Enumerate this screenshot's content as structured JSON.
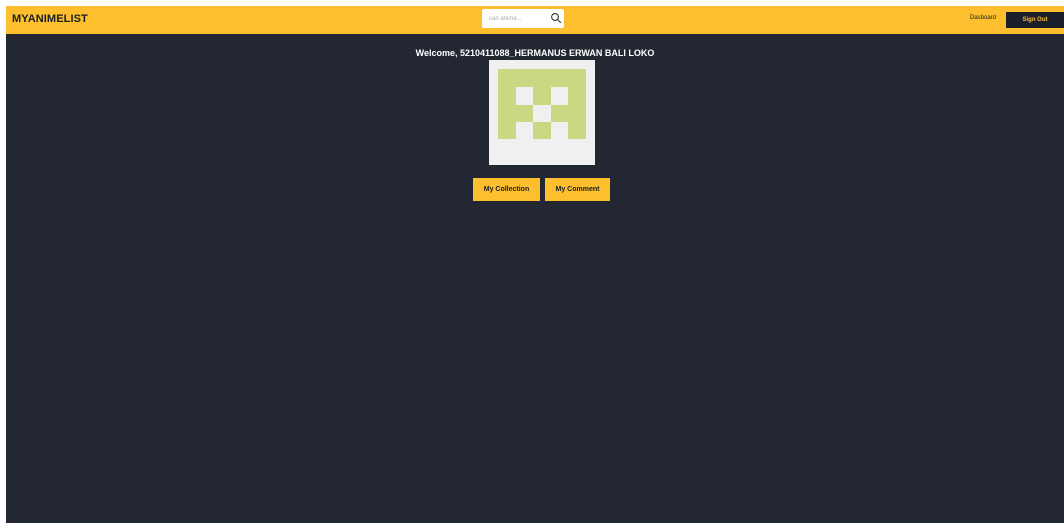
{
  "navbar": {
    "brand": "MYANIMELIST",
    "search": {
      "placeholder": "cari anime...",
      "value": ""
    },
    "dashboard_label": "Dasboard",
    "signout_label": "Sign Out"
  },
  "profile": {
    "welcome_text": "Welcome, 5210411088_HERMANUS ERWAN BALI LOKO",
    "avatar_icon": "identicon-avatar",
    "buttons": {
      "collection_label": "My Collection",
      "comment_label": "My Comment"
    }
  },
  "colors": {
    "accent": "#fdbf2d",
    "background": "#222732",
    "avatar_fill": "#ccd783",
    "avatar_bg": "#f0f0f0"
  }
}
